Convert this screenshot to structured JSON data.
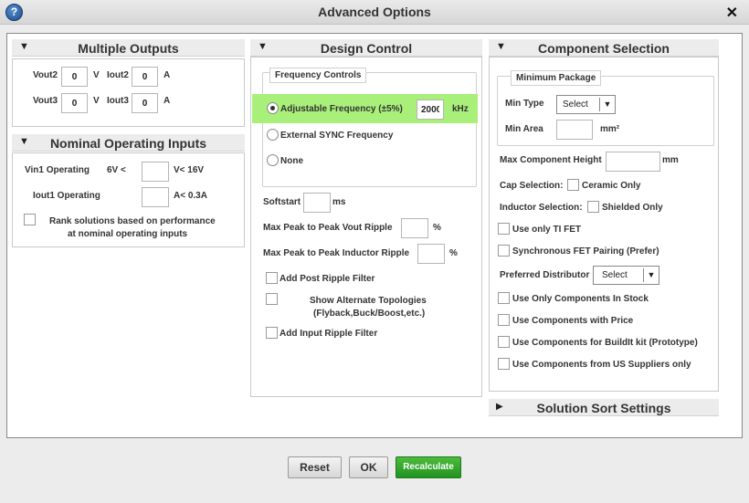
{
  "dialog": {
    "title": "Advanced Options"
  },
  "multiple_outputs": {
    "title": "Multiple Outputs",
    "vout2_label": "Vout2",
    "vout2_value": "0",
    "v_unit": "V",
    "iout2_label": "Iout2",
    "iout2_value": "0",
    "a_unit": "A",
    "vout3_label": "Vout3",
    "vout3_value": "0",
    "iout3_label": "Iout3",
    "iout3_value": "0"
  },
  "nominal_inputs": {
    "title": "Nominal Operating Inputs",
    "vin1_label": "Vin1 Operating",
    "vin1_min": "6V <",
    "vin1_value": "",
    "vin1_max": "V< 16V",
    "iout1_label": "Iout1 Operating",
    "iout1_value": "",
    "iout1_max": "A< 0.3A",
    "rank_label_1": "Rank solutions based on performance",
    "rank_label_2": "at nominal operating inputs"
  },
  "design_control": {
    "title": "Design Control",
    "freq_legend": "Frequency Controls",
    "adjustable_label": "Adjustable Frequency (±5%)",
    "freq_value": "2000",
    "freq_unit": "kHz",
    "external_label": "External SYNC Frequency",
    "none_label": "None",
    "softstart_label": "Softstart",
    "softstart_value": "",
    "ms_unit": "ms",
    "vout_ripple_label": "Max Peak to Peak Vout Ripple",
    "vout_ripple_value": "",
    "pct": "%",
    "ind_ripple_label": "Max Peak to Peak Inductor Ripple",
    "ind_ripple_value": "",
    "post_filter_label": "Add Post Ripple Filter",
    "alt_topo_label_1": "Show Alternate Topologies",
    "alt_topo_label_2": "(Flyback,Buck/Boost,etc.)",
    "input_filter_label": "Add Input Ripple Filter",
    "highlight_color": "#a9f07a"
  },
  "component_selection": {
    "title": "Component Selection",
    "min_pkg_legend": "Minimum Package",
    "min_type_label": "Min Type",
    "min_type_value": "Select",
    "min_area_label": "Min Area",
    "min_area_value": "",
    "mm2_unit": "mm²",
    "max_height_label": "Max Component Height",
    "max_height_value": "",
    "mm_unit": "mm",
    "cap_label": "Cap Selection:",
    "ceramic_label": "Ceramic Only",
    "inductor_label": "Inductor Selection:",
    "shielded_label": "Shielded Only",
    "ti_fet_label": "Use only TI FET",
    "sync_fet_label": "Synchronous FET Pairing (Prefer)",
    "distributor_label": "Preferred Distributor",
    "distributor_value": "Select",
    "in_stock_label": "Use Only Components In Stock",
    "with_price_label": "Use Components with Price",
    "buildit_label": "Use Components for BuildIt kit (Prototype)",
    "us_suppliers_label": "Use Components from US Suppliers only"
  },
  "solution_sort": {
    "title": "Solution Sort Settings"
  },
  "footer": {
    "reset_label": "Reset",
    "ok_label": "OK",
    "recalc_label": "Recalculate"
  }
}
